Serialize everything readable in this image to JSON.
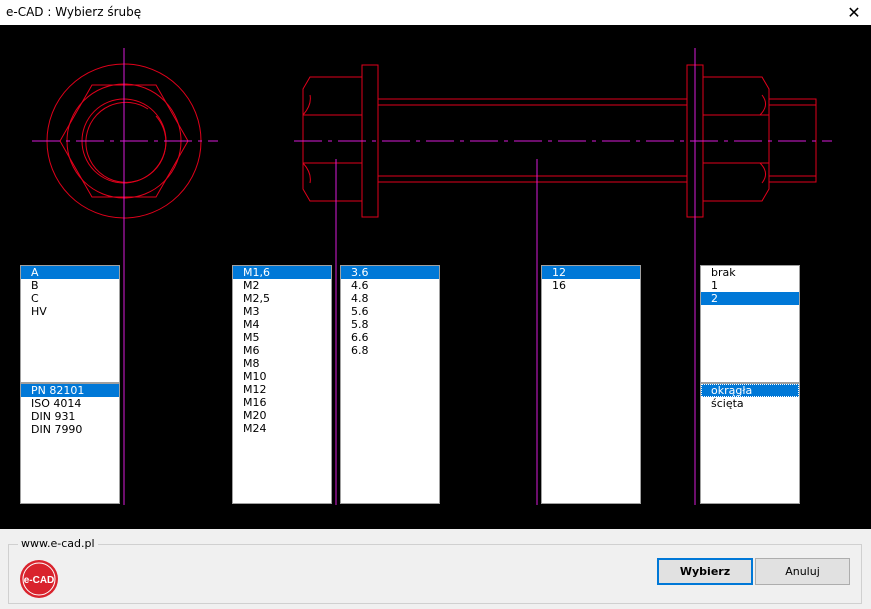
{
  "window": {
    "title": "e-CAD : Wybierz śrubę",
    "close_glyph": "✕"
  },
  "lists": {
    "type": {
      "items": [
        "A",
        "B",
        "C",
        "HV"
      ],
      "selected": 0
    },
    "standard": {
      "items": [
        "PN 82101",
        "ISO 4014",
        "DIN 931",
        "DIN 7990"
      ],
      "selected": 0
    },
    "size": {
      "items": [
        "M1,6",
        "M2",
        "M2,5",
        "M3",
        "M4",
        "M5",
        "M6",
        "M8",
        "M10",
        "M12",
        "M16",
        "M20",
        "M24"
      ],
      "selected": 0
    },
    "grade": {
      "items": [
        "3.6",
        "4.6",
        "4.8",
        "5.6",
        "5.8",
        "6.6",
        "6.8"
      ],
      "selected": 0
    },
    "length": {
      "items": [
        "12",
        "16"
      ],
      "selected": 0
    },
    "nuts": {
      "items": [
        "brak",
        "1",
        "2"
      ],
      "selected": 2
    },
    "washer": {
      "items": [
        "okrągła",
        "ścięta"
      ],
      "selected": 0
    }
  },
  "footer": {
    "group_label": "www.e-cad.pl",
    "logo_text": "e-CAD",
    "select_button": "Wybierz",
    "cancel_button": "Anuluj"
  },
  "colors": {
    "drawing_red": "#e0001b",
    "axis_magenta": "#d81bd8",
    "selection_blue": "#0078d7",
    "logo_red": "#d9232d"
  }
}
